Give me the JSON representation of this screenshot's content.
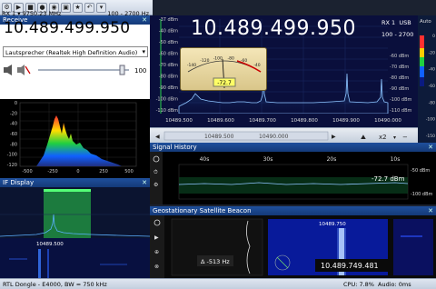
{
  "toolbar": {
    "icons": [
      "gear-icon",
      "play-icon",
      "stop-icon",
      "record-icon",
      "record-video-icon",
      "camera-icon",
      "star-icon",
      "undo-icon",
      "menu-icon"
    ]
  },
  "receive": {
    "title": "Receive",
    "rx_label": "RX 1",
    "rx_freq_small": "9750.23 MHz",
    "rx_range": "100 - 2700 Hz",
    "frequency": "10.489.499.950",
    "audio_device": "Lautsprecher (Realtek High Definition Audio)",
    "volume_value": "100",
    "volume_level": 0.92
  },
  "left_spectrum": {
    "y_ticks": [
      "0",
      "-20",
      "-40",
      "-60",
      "-80",
      "-100",
      "-120"
    ],
    "x_ticks": [
      "-500",
      "-250",
      "0",
      "250",
      "500"
    ]
  },
  "if_display": {
    "title": "IF Display",
    "freq_label": "10489.500",
    "freq_label2": "10489.500"
  },
  "main": {
    "frequency": "10.489.499.950",
    "rx_label": "RX 1",
    "usb_label": "USB",
    "range": "100 - 2700",
    "y_ticks_left": [
      "-37 dBm",
      "-40 dBm",
      "-50 dBm",
      "-60 dBm",
      "-70 dBm",
      "-80 dBm",
      "-90 dBm",
      "-100 dBm",
      "-110 dBm"
    ],
    "y_ticks_right": [
      "-60 dBm",
      "-70 dBm",
      "-80 dBm",
      "-90 dBm",
      "-100 dBm",
      "-110 dBm"
    ],
    "x_ticks": [
      "10489.500",
      "10489.600",
      "10489.700",
      "10489.800",
      "10489.900",
      "10490.000"
    ],
    "meter_value": "-72.7",
    "meter_scale": [
      "-140",
      "-120",
      "-100",
      "-80",
      "-60",
      "-40"
    ],
    "auto_label": "Auto",
    "side_ticks": [
      "0",
      "-20",
      "-40",
      "-60",
      "-80",
      "-100",
      "-150"
    ]
  },
  "navbar": {
    "left_label": "10489.500",
    "mid_label": "10490.000",
    "zoom": "x2"
  },
  "signal_history": {
    "title": "Signal History",
    "x_ticks": [
      "40s",
      "30s",
      "20s",
      "10s"
    ],
    "y_ticks": [
      "-50 dBm",
      "-100 dBm"
    ],
    "reading": "-72.7 dBm"
  },
  "geo": {
    "title": "Geostationary Satellite Beacon",
    "delta": "Δ -513 Hz",
    "beacon_freq_top": "10489.750",
    "beacon_freq": "10.489.749.481"
  },
  "status": {
    "device": "RTL Dongle - E4000, BW = 750 kHz",
    "cpu": "CPU: 7.8%",
    "audio": "Audio: 0ms"
  },
  "colors": {
    "panel_header": "#1f4f9c",
    "spectrum_bg": "#0a0f3c",
    "trace": "#3a8fd8",
    "meter_face": "#f4e6b8",
    "if_highlight": "#2bd04b"
  }
}
